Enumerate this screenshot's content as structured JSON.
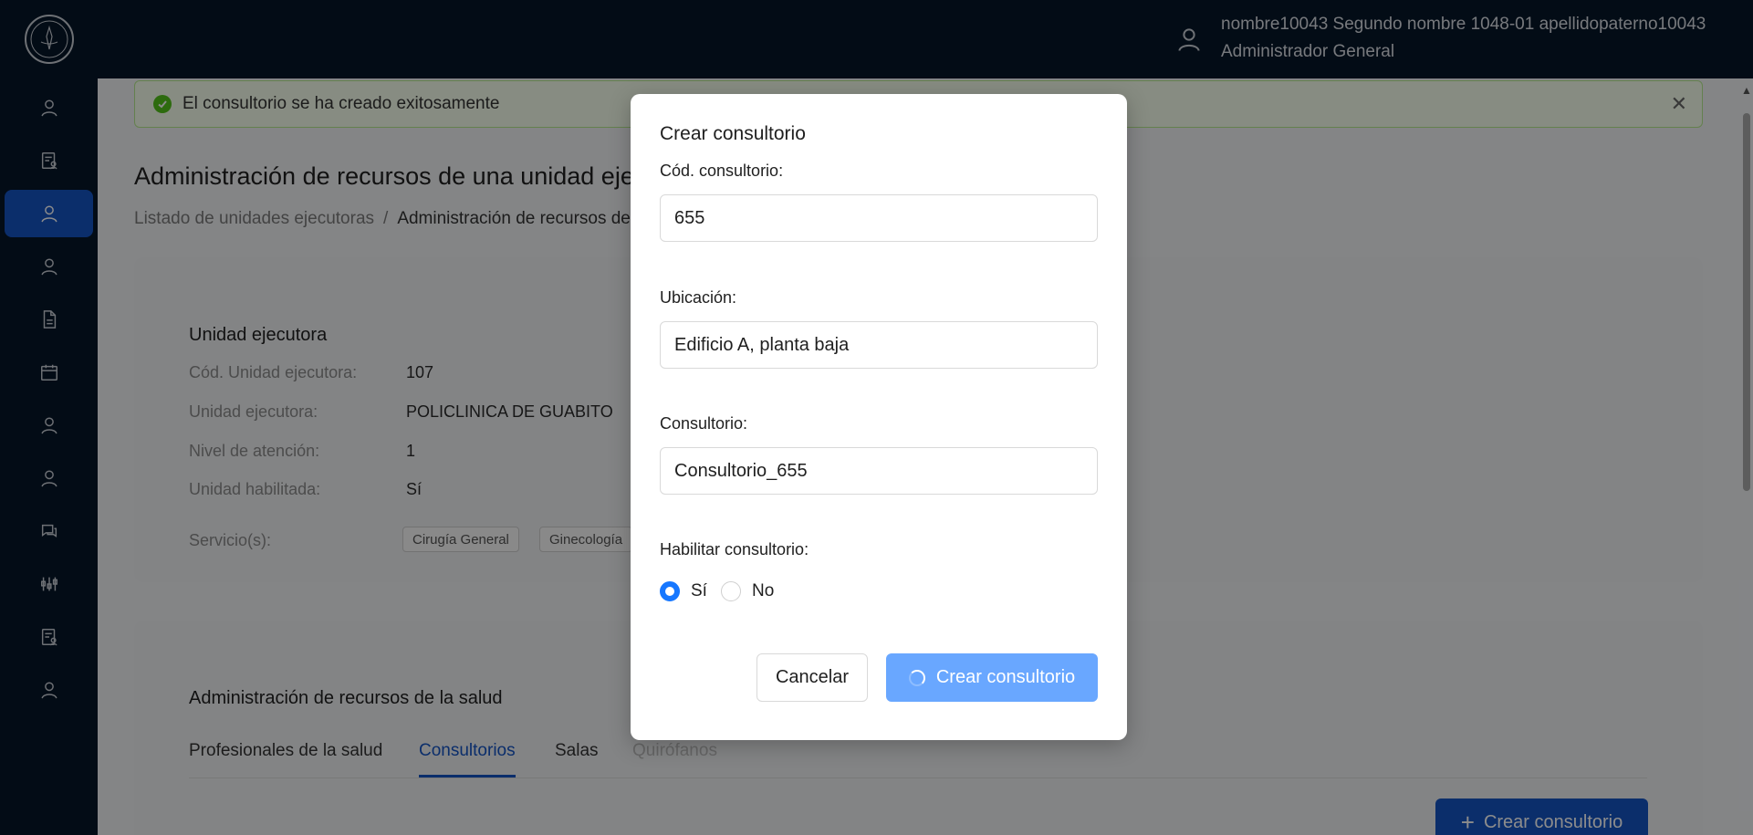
{
  "header": {
    "user_name": "nombre10043 Segundo nombre 1048-01 apellidopaterno10043",
    "user_role": "Administrador General",
    "logo_icon": "css-panama-seal-logo",
    "user_icon": "user-icon"
  },
  "sidebar": {
    "items": [
      {
        "icon": "user-icon"
      },
      {
        "icon": "document-user-icon"
      },
      {
        "icon": "user-icon",
        "active": true
      },
      {
        "icon": "user-icon"
      },
      {
        "icon": "file-icon"
      },
      {
        "icon": "calendar-icon"
      },
      {
        "icon": "user-icon"
      },
      {
        "icon": "user-icon"
      },
      {
        "icon": "chat-icon"
      },
      {
        "icon": "sliders-icon"
      },
      {
        "icon": "document-user-icon"
      },
      {
        "icon": "user-icon"
      }
    ]
  },
  "alert": {
    "message": "El consultorio se ha creado exitosamente",
    "close_symbol": "✕"
  },
  "page": {
    "title": "Administración de recursos de una unidad ejecutora",
    "breadcrumb": {
      "root": "Listado de unidades ejecutoras",
      "separator": "/",
      "current": "Administración de recursos de una unidad ejecutora"
    }
  },
  "unit_card": {
    "title": "Unidad ejecutora",
    "fields": [
      {
        "label": "Cód. Unidad ejecutora:",
        "value": "107"
      },
      {
        "label": "Unidad ejecutora:",
        "value": "POLICLINICA DE GUABITO"
      },
      {
        "label": "Nivel de atención:",
        "value": "1"
      },
      {
        "label": "Unidad habilitada:",
        "value": "Sí"
      }
    ],
    "services_label": "Servicio(s):",
    "services": [
      "Cirugía General",
      "Ginecología"
    ]
  },
  "resources_card": {
    "title": "Administración de recursos de la salud",
    "tabs": [
      "Profesionales de la salud",
      "Consultorios",
      "Salas",
      "Quirófanos"
    ],
    "active_tab": "Consultorios",
    "create_button": "Crear consultorio",
    "create_symbol": "+"
  },
  "modal": {
    "title": "Crear consultorio",
    "code_label": "Cód. consultorio:",
    "code_value": "655",
    "location_label": "Ubicación:",
    "location_value": "Edificio A, planta baja",
    "office_label": "Consultorio:",
    "office_value": "Consultorio_655",
    "enable_label": "Habilitar consultorio:",
    "option_yes": "Sí",
    "option_no": "No",
    "selected": "Sí",
    "cancel_button": "Cancelar",
    "create_button": "Crear consultorio"
  },
  "colors": {
    "nav_bg": "#071629",
    "primary": "#1554c4",
    "success": "#52c41a",
    "loading_button": "#69a7ff"
  }
}
